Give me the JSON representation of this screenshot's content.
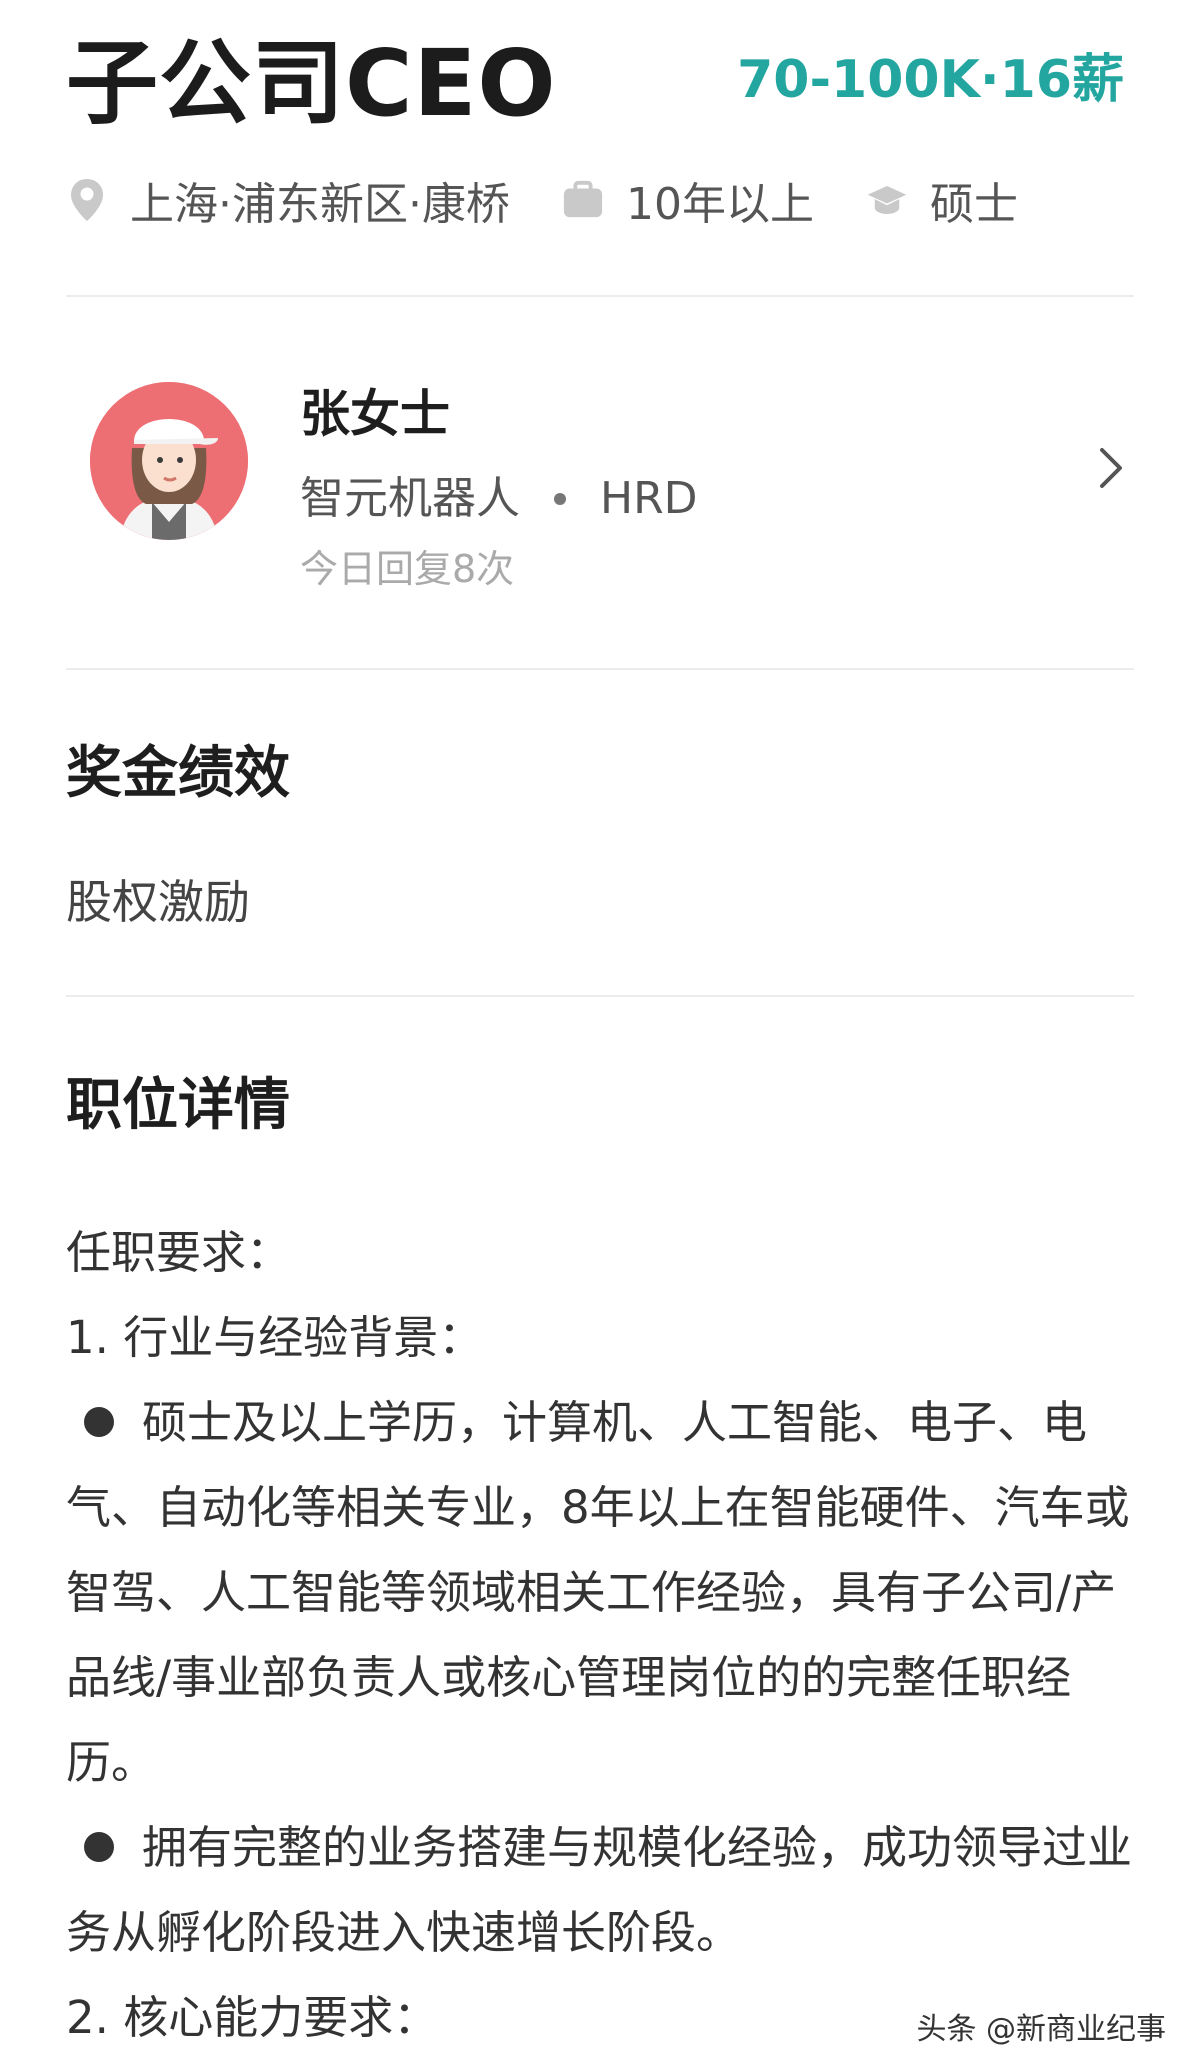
{
  "job": {
    "title": "子公司CEO",
    "salary": "70-100K·16薪",
    "location": "上海·浦东新区·康桥",
    "experience": "10年以上",
    "education": "硕士"
  },
  "recruiter": {
    "name": "张女士",
    "company": "智元机器人",
    "role": "HRD",
    "reply_note": "今日回复8次"
  },
  "bonus": {
    "title": "奖金绩效",
    "content": "股权激励"
  },
  "details": {
    "title": "职位详情",
    "requirements_heading": "任职要求：",
    "item1_heading": "1. 行业与经验背景：",
    "item1_bullet1": "硕士及以上学历，计算机、人工智能、电子、电气、自动化等相关专业，8年以上在智能硬件、汽车或智驾、人工智能等领域相关工作经验，具有子公司/产品线/事业部负责人或核心管理岗位的的完整任职经历。",
    "item1_bullet2": "拥有完整的业务搭建与规模化经验，成功领导过业务从孵化阶段进入快速增长阶段。",
    "item2_heading": "2. 核心能力要求："
  },
  "watermark": "头条 @新商业纪事",
  "icons": {
    "location": "location-pin-icon",
    "experience": "briefcase-icon",
    "education": "graduation-cap-icon",
    "chevron": "chevron-right-icon"
  },
  "colors": {
    "salary": "#23a6a0",
    "avatar_bg": "#ee6f73"
  }
}
